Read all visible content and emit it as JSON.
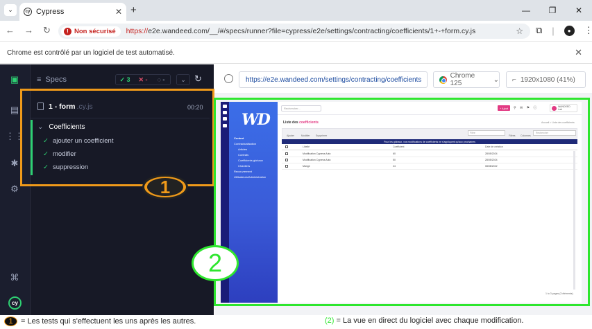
{
  "browser": {
    "tab_title": "Cypress",
    "security_label": "Non sécurisé",
    "url_scheme": "https://",
    "url_rest": "e2e.wandeed.com/__/#/specs/runner?file=cypress/e2e/settings/contracting/coefficients/1+-+form.cy.js",
    "infobar_text": "Chrome est contrôlé par un logiciel de test automatisé."
  },
  "specs_panel": {
    "title": "Specs",
    "passed": "3",
    "failed": "✕ -",
    "pending": "-",
    "spec_name": "1 - form",
    "spec_ext": ".cy.js",
    "duration": "00:20",
    "suite_title": "Coefficients",
    "tests": [
      {
        "label": "ajouter un coefficient"
      },
      {
        "label": "modifier"
      },
      {
        "label": "suppression"
      }
    ]
  },
  "aut": {
    "url": "https://e2e.wandeed.com/settings/contracting/coefficients",
    "browser": "Chrome 125",
    "viewport": "1920x1080 (41%)"
  },
  "app": {
    "logo": "WD",
    "search_placeholder": "Rechercher...",
    "add_label": "+ Ajout",
    "user_name": "WANDEED",
    "user_role": "Lab",
    "page_title": "Liste des",
    "page_title_accent": "coefficients",
    "breadcrumb": "Accueil > Liste des coefficients",
    "sidebar": [
      "Contrat",
      "Contractualisation",
      "Articles",
      "Contrats",
      "Coefficients globaux",
      "Chantiers",
      "Recouvrement",
      "Utilisateurs/Administration"
    ],
    "toolbar": [
      "Ajouter",
      "Modifier",
      "Supprimer"
    ],
    "select_placeholder": "Filtre",
    "toolbar_right": [
      "Filtres",
      "Colonnes"
    ],
    "table_search_placeholder": "Rechercher",
    "banner": "Pour les globaux, vos modifications de coefficients ne s'appliquent qu'aux prochaines",
    "columns": [
      "Libellé",
      "Coefficient",
      "Date de création"
    ],
    "rows": [
      [
        "Modification Cypress Auto",
        "60",
        "28/05/2024"
      ],
      [
        "Modification Cypress Auto",
        "50",
        "28/05/2024"
      ],
      [
        "Mange",
        "24",
        "08/08/2022"
      ]
    ],
    "pagination": "1 to 3 pages (3 éléments)"
  },
  "annotations": {
    "label_1": "1",
    "label_2": "2",
    "caption_1_num": "1",
    "caption_1": "= Les tests qui s'effectuent les uns après les autres.",
    "caption_2_num": "(2)",
    "caption_2": " = La vue en direct du logiciel avec chaque modification."
  },
  "colors": {
    "orange_annotation": "#f09a1a",
    "green_annotation": "#2ee62e",
    "cypress_pass": "#2ed073",
    "cypress_bg": "#171926"
  }
}
